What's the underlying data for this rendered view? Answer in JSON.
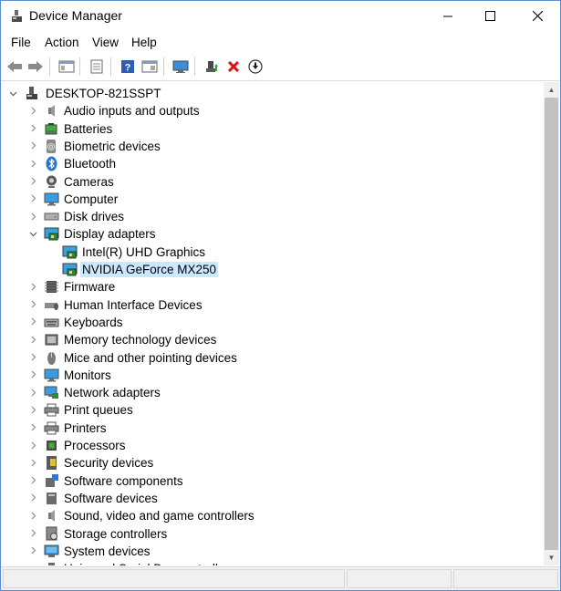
{
  "window": {
    "title": "Device Manager",
    "accent_border": "#5b8fd1"
  },
  "menu": [
    "File",
    "Action",
    "View",
    "Help"
  ],
  "toolbar": [
    "back-icon",
    "forward-icon",
    "show-hide-console-tree-icon",
    "properties-icon",
    "help-icon",
    "action-pane-icon",
    "scan-hardware-icon",
    "update-driver-icon",
    "uninstall-device-icon",
    "disable-device-icon"
  ],
  "tree": {
    "root": "DESKTOP-821SSPT",
    "categories": [
      {
        "label": "Audio inputs and outputs",
        "icon": "speaker-icon"
      },
      {
        "label": "Batteries",
        "icon": "battery-icon"
      },
      {
        "label": "Biometric devices",
        "icon": "fingerprint-icon"
      },
      {
        "label": "Bluetooth",
        "icon": "bluetooth-icon"
      },
      {
        "label": "Cameras",
        "icon": "camera-icon"
      },
      {
        "label": "Computer",
        "icon": "computer-icon"
      },
      {
        "label": "Disk drives",
        "icon": "disk-drive-icon"
      },
      {
        "label": "Display adapters",
        "icon": "display-adapter-icon",
        "expanded": true,
        "children": [
          {
            "label": "Intel(R) UHD Graphics",
            "icon": "display-adapter-icon"
          },
          {
            "label": "NVIDIA GeForce MX250",
            "icon": "display-adapter-icon",
            "selected": true
          }
        ]
      },
      {
        "label": "Firmware",
        "icon": "firmware-icon"
      },
      {
        "label": "Human Interface Devices",
        "icon": "hid-icon"
      },
      {
        "label": "Keyboards",
        "icon": "keyboard-icon"
      },
      {
        "label": "Memory technology devices",
        "icon": "memory-icon"
      },
      {
        "label": "Mice and other pointing devices",
        "icon": "mouse-icon"
      },
      {
        "label": "Monitors",
        "icon": "monitor-icon"
      },
      {
        "label": "Network adapters",
        "icon": "network-icon"
      },
      {
        "label": "Print queues",
        "icon": "printer-icon"
      },
      {
        "label": "Printers",
        "icon": "printer-icon"
      },
      {
        "label": "Processors",
        "icon": "processor-icon"
      },
      {
        "label": "Security devices",
        "icon": "security-icon"
      },
      {
        "label": "Software components",
        "icon": "software-component-icon"
      },
      {
        "label": "Software devices",
        "icon": "software-device-icon"
      },
      {
        "label": "Sound, video and game controllers",
        "icon": "speaker-icon"
      },
      {
        "label": "Storage controllers",
        "icon": "storage-icon"
      },
      {
        "label": "System devices",
        "icon": "system-icon"
      },
      {
        "label": "Universal Serial Bus controllers",
        "icon": "usb-icon"
      }
    ]
  },
  "colors": {
    "selection": "#cce8ff",
    "scroll_thumb": "#c2c2c2"
  }
}
